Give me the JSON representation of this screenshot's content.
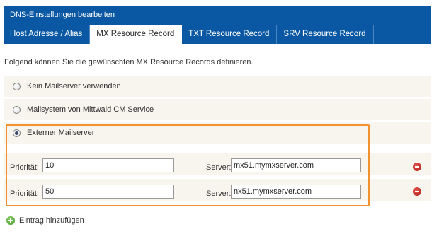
{
  "panel": {
    "title": "DNS-Einstellungen bearbeiten"
  },
  "tabs": [
    {
      "label": "Host Adresse / Alias",
      "active": false
    },
    {
      "label": "MX Resource Record",
      "active": true
    },
    {
      "label": "TXT Resource Record",
      "active": false
    },
    {
      "label": "SRV Resource Record",
      "active": false
    }
  ],
  "intro": "Folgend können Sie die gewünschten MX Resource Records definieren.",
  "options": [
    {
      "label": "Kein Mailserver verwenden",
      "checked": false
    },
    {
      "label": "Mailsystem von Mittwald CM Service",
      "checked": false
    },
    {
      "label": "Externer Mailserver",
      "checked": true
    }
  ],
  "entries": [
    {
      "priority_label": "Priorität:",
      "priority": "10",
      "server_label": "Server:",
      "server": "mx51.mymxserver.com"
    },
    {
      "priority_label": "Priorität:",
      "priority": "50",
      "server_label": "Server:",
      "server": "nx51.mymxserver.com"
    }
  ],
  "add_entry": {
    "label": "Eintrag hinzufügen",
    "icon": "plus-circle-icon"
  },
  "colors": {
    "header": "#0a58a3",
    "highlight": "#f0922e",
    "row_bg": "#f8f4ee",
    "remove": "#c8231b",
    "add": "#5aad34"
  }
}
